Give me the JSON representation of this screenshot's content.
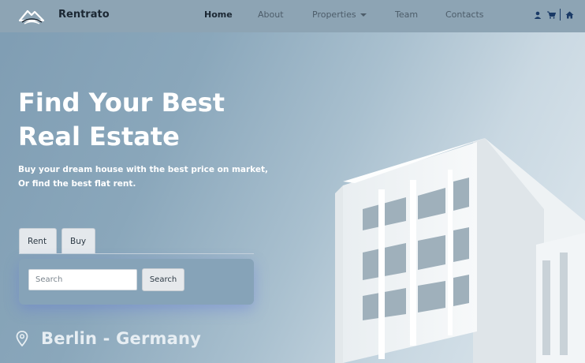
{
  "brand": {
    "name": "Rentrato",
    "logo_icon": "mountain-logo-icon"
  },
  "nav": {
    "items": [
      {
        "label": "Home",
        "active": true
      },
      {
        "label": "About",
        "active": false
      },
      {
        "label": "Properties",
        "active": false,
        "has_dropdown": true
      },
      {
        "label": "Team",
        "active": false
      },
      {
        "label": "Contacts",
        "active": false
      }
    ],
    "icons": [
      "user-icon",
      "cart-icon",
      "home-icon"
    ],
    "icon_color": "#1a3a66"
  },
  "hero": {
    "title_line1": "Find Your Best",
    "title_line2": "Real Estate",
    "subtitle_line1": "Buy your dream house with the best price on market,",
    "subtitle_line2": "Or find the best flat rent."
  },
  "tabs": [
    {
      "label": "Rent"
    },
    {
      "label": "Buy"
    }
  ],
  "search": {
    "placeholder": "Search",
    "button_label": "Search"
  },
  "location": {
    "text": "Berlin - Germany",
    "icon": "location-pin-icon"
  },
  "colors": {
    "navbar": "#8da4b4",
    "hero_text": "#ffffff",
    "panel": "#86a3b8"
  }
}
